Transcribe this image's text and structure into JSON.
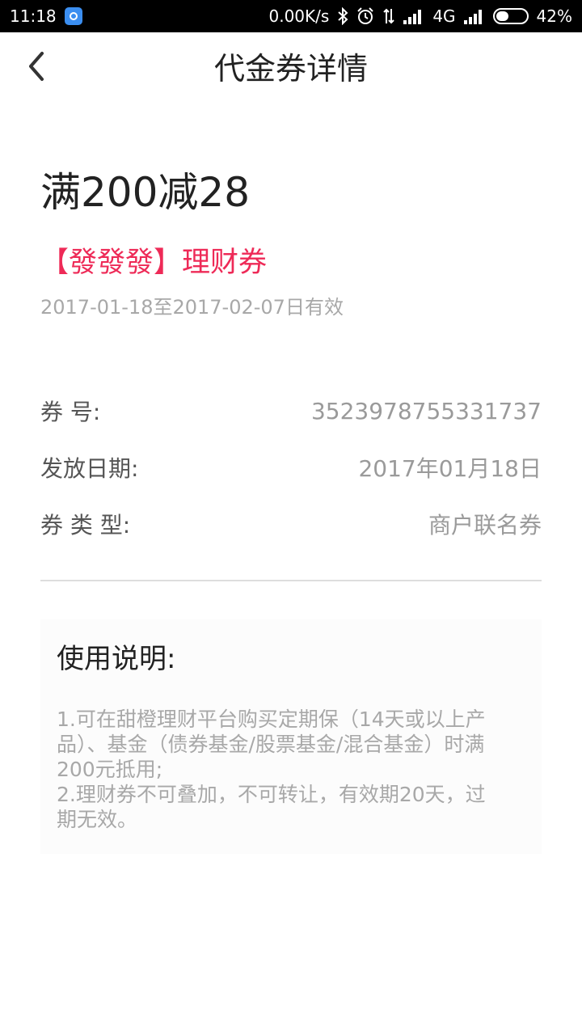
{
  "status_bar": {
    "time": "11:18",
    "network_speed": "0.00K/s",
    "network_type": "4G",
    "battery_percent": "42%",
    "battery_level": 0.42,
    "icons": [
      "app-badge-icon",
      "bluetooth-icon",
      "alarm-icon",
      "data-transfer-icon",
      "signal-icon",
      "signal-icon",
      "battery-icon"
    ]
  },
  "header": {
    "title": "代金券详情",
    "back_icon": "chevron-left-icon"
  },
  "coupon": {
    "amount": "满200减28",
    "name": "【發發發】理财券",
    "validity": "2017-01-18至2017-02-07日有效",
    "name_color": "#ee2a57"
  },
  "details": [
    {
      "label": "券 号:",
      "value": "3523978755331737"
    },
    {
      "label": "发放日期:",
      "value": "2017年01月18日"
    },
    {
      "label": "券 类 型:",
      "value": "商户联名券"
    }
  ],
  "usage": {
    "title": "使用说明:",
    "lines": [
      "1.可在甜橙理财平台购买定期保（14天或以上产品）、基金（债券基金/股票基金/混合基金）时满200元抵用;",
      "2.理财券不可叠加，不可转让，有效期20天，过期无效。"
    ]
  }
}
